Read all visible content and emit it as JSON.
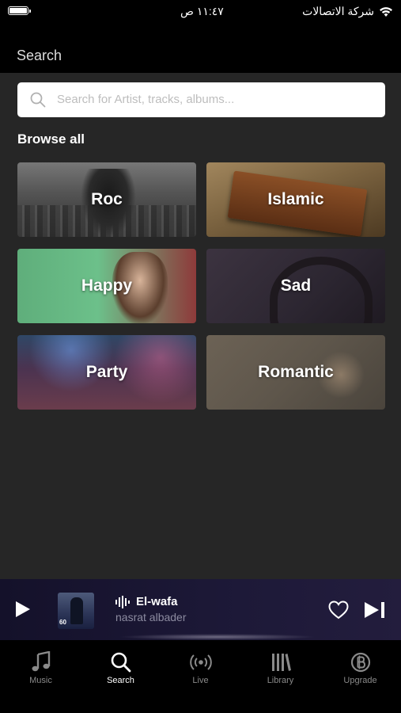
{
  "status_bar": {
    "carrier": "شركة الاتصالات",
    "time": "١١:٤٧ ص"
  },
  "header": {
    "title": "Search"
  },
  "search": {
    "placeholder": "Search for Artist, tracks, albums..."
  },
  "browse": {
    "title": "Browse all",
    "categories": [
      {
        "label": "Roc"
      },
      {
        "label": "Islamic"
      },
      {
        "label": "Happy"
      },
      {
        "label": "Sad"
      },
      {
        "label": "Party"
      },
      {
        "label": "Romantic"
      }
    ]
  },
  "now_playing": {
    "title": "El-wafa",
    "artist": "nasrat albader",
    "artwork_badge": "60"
  },
  "tabs": [
    {
      "label": "Music",
      "icon": "music-note-icon"
    },
    {
      "label": "Search",
      "icon": "search-icon",
      "active": true
    },
    {
      "label": "Live",
      "icon": "broadcast-icon"
    },
    {
      "label": "Library",
      "icon": "library-icon"
    },
    {
      "label": "Upgrade",
      "icon": "upgrade-icon"
    }
  ],
  "colors": {
    "background": "#262626",
    "header": "#000000",
    "player_bg": "#1d1938",
    "inactive_tab": "#8a8a8a"
  }
}
